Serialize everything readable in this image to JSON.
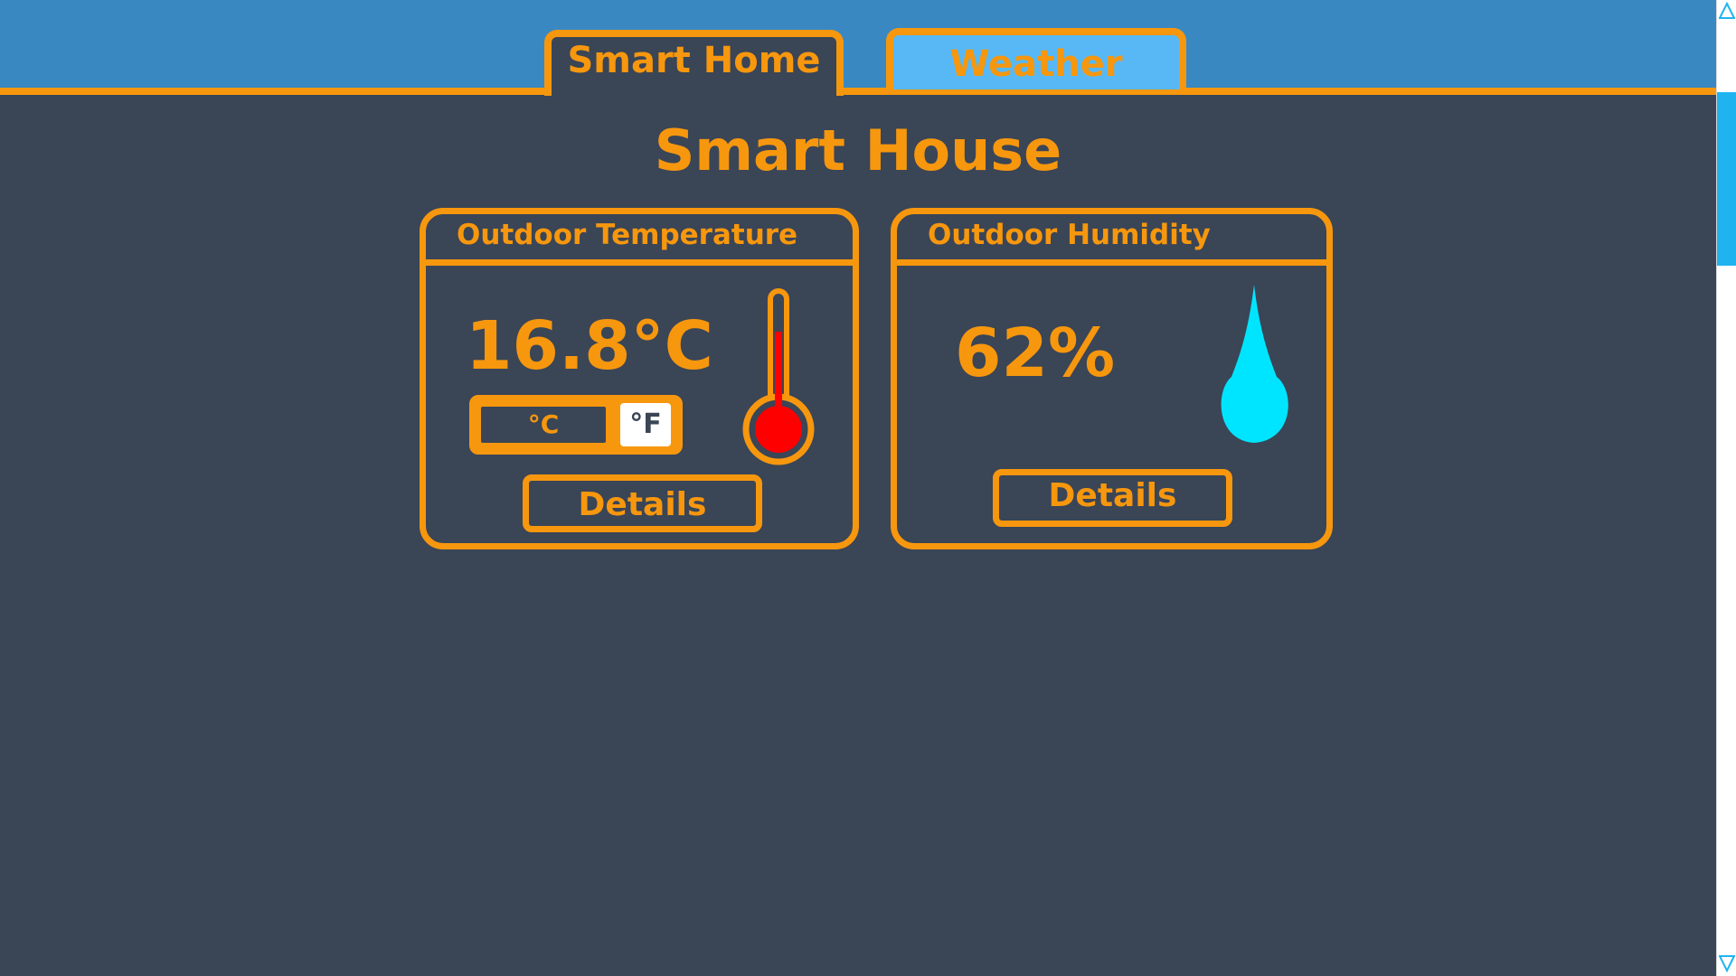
{
  "tabs": [
    {
      "label": "Smart Home"
    },
    {
      "label": "Weather"
    }
  ],
  "page": {
    "title": "Smart House"
  },
  "temperature_card": {
    "title": "Outdoor Temperature",
    "value": "16.8°C",
    "unit_celsius": "°C",
    "unit_fahrenheit": "°F",
    "details_label": "Details",
    "icon": "thermometer-icon"
  },
  "humidity_card": {
    "title": "Outdoor Humidity",
    "value": "62%",
    "details_label": "Details",
    "icon": "water-drop-icon"
  },
  "colors": {
    "accent": "#f7970e",
    "background": "#3a4556",
    "header": "#3a88c2",
    "active_tab": "#57b8f5",
    "thermometer": "#ff0000",
    "drop": "#00e5ff",
    "scroll_thumb": "#1fb4f0"
  }
}
